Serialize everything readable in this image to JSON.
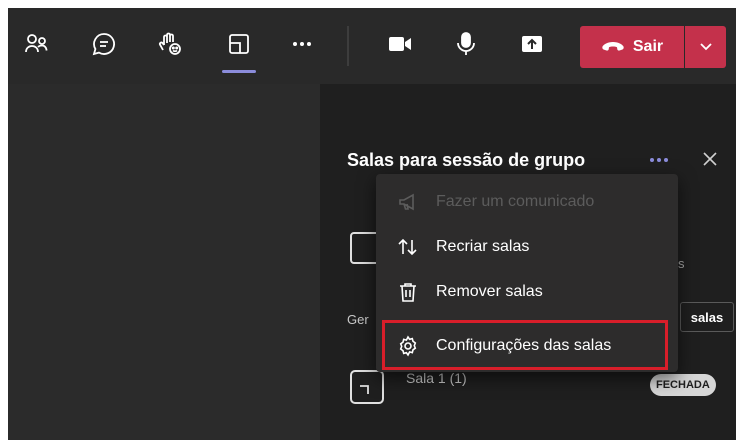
{
  "toolbar": {
    "buttons": [
      {
        "name": "participants",
        "icon": "people-icon"
      },
      {
        "name": "chat",
        "icon": "chat-icon"
      },
      {
        "name": "reactions",
        "icon": "raise-hand-icon"
      },
      {
        "name": "breakout-rooms",
        "icon": "breakout-rooms-icon",
        "active": true
      },
      {
        "name": "more-actions",
        "icon": "more-icon"
      },
      {
        "name": "camera",
        "icon": "camera-icon"
      },
      {
        "name": "microphone",
        "icon": "mic-icon"
      },
      {
        "name": "share",
        "icon": "share-icon"
      }
    ],
    "leave_label": "Sair"
  },
  "panel": {
    "title": "Salas para sessão de grupo",
    "peek_text_right": "s",
    "peek_text_left": "Ger",
    "peek_button": "salas",
    "room": {
      "name": "Sala 1 (1)",
      "status": "FECHADA"
    }
  },
  "menu": {
    "items": [
      {
        "label": "Fazer um comunicado",
        "icon": "megaphone-icon",
        "disabled": true
      },
      {
        "label": "Recriar salas",
        "icon": "sort-arrows-icon",
        "disabled": false
      },
      {
        "label": "Remover salas",
        "icon": "trash-icon",
        "disabled": false
      },
      {
        "label": "Configurações das salas",
        "icon": "gear-icon",
        "disabled": false
      }
    ]
  },
  "colors": {
    "accent": "#8b8cdb",
    "leave": "#c4314b",
    "highlight": "#d81e2a",
    "toolbar_bg": "#292929",
    "panel_bg": "#1f1f1f",
    "menu_bg": "#2d2c2c"
  }
}
